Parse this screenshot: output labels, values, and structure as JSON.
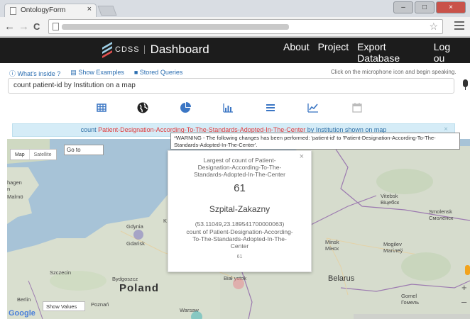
{
  "browser": {
    "tab_title": "OntologyForm",
    "tab_close": "×",
    "nav_back": "←",
    "nav_forward": "→",
    "nav_reload": "C",
    "star": "☆",
    "minimize": "–",
    "maximize": "□",
    "close": "×"
  },
  "navbar": {
    "logo_text": "CDSS",
    "title": "Dashboard",
    "links": [
      "About",
      "Project",
      "Export Database",
      "Log ou"
    ]
  },
  "toolbar": {
    "whats_inside": "What's inside ?",
    "show_examples": "Show Examples",
    "stored_queries": "Stored Queries",
    "hint": "Click on the microphone icon and begin speaking.",
    "query_value": "count patient-id by Institution on a map"
  },
  "chart_icons": [
    "table-icon",
    "globe-icon",
    "pie-chart-icon",
    "bar-chart-icon",
    "list-icon",
    "line-chart-icon",
    "calendar-icon"
  ],
  "info": {
    "prefix": "count ",
    "highlight": "Patient-Designation-According-To-The-Standards-Adopted-In-The-Center",
    "suffix": " by Institution shown on map",
    "close": "×"
  },
  "warning": "*WARNING - The following changes has been performed: 'patient-id' to 'Patient-Designation-According-To-The-Standards-Adopted-In-The-Center'.",
  "map": {
    "map_btn": "Map",
    "satellite_btn": "Satellite",
    "goto": "Go to",
    "show_values": "Show Values",
    "google": "Google",
    "zoom_in": "+",
    "zoom_out": "–",
    "labels": {
      "copenhagen": "hagen",
      "copenhagen2": "n",
      "malmo": "Malmö",
      "gdynia": "Gdynia",
      "gdansk": "Gdańsk",
      "szczecin": "Szczecin",
      "bydgoszcz": "Bydgoszcz",
      "poland": "Poland",
      "berlin": "Berlin",
      "poznan": "Poznań",
      "warsaw": "Warsaw",
      "bialystok": "Biał  ystok",
      "belarus": "Belarus",
      "minsk": "Minsk",
      "minsk_cy": "Мінск",
      "vitebsk": "Vitebsk",
      "vitebsk_cy": "Віцебск",
      "smolensk": "Smolensk",
      "smolensk_cy": "Смоленск",
      "mogilev": "Mogilev",
      "mogilev_cy": "Магілёў",
      "gomel": "Gomel",
      "gomel_cy": "Гомель",
      "k": "K"
    }
  },
  "popup": {
    "close": "×",
    "heading": "Largest of count of Patient-Designation-According-To-The-Standards-Adopted-In-The-Center",
    "value": "61",
    "name": "Szpital-Zakazny",
    "coords": "(53.11049,23.189541700000063)",
    "sub": "count of Patient-Designation-According-To-The-Standards-Adopted-In-The-Center",
    "sub_value": "61"
  },
  "colors": {
    "navbar": "#1c1c1c",
    "accent": "#2a6db0",
    "highlight": "#e03a3a",
    "info_bg": "#d5ecf7"
  }
}
